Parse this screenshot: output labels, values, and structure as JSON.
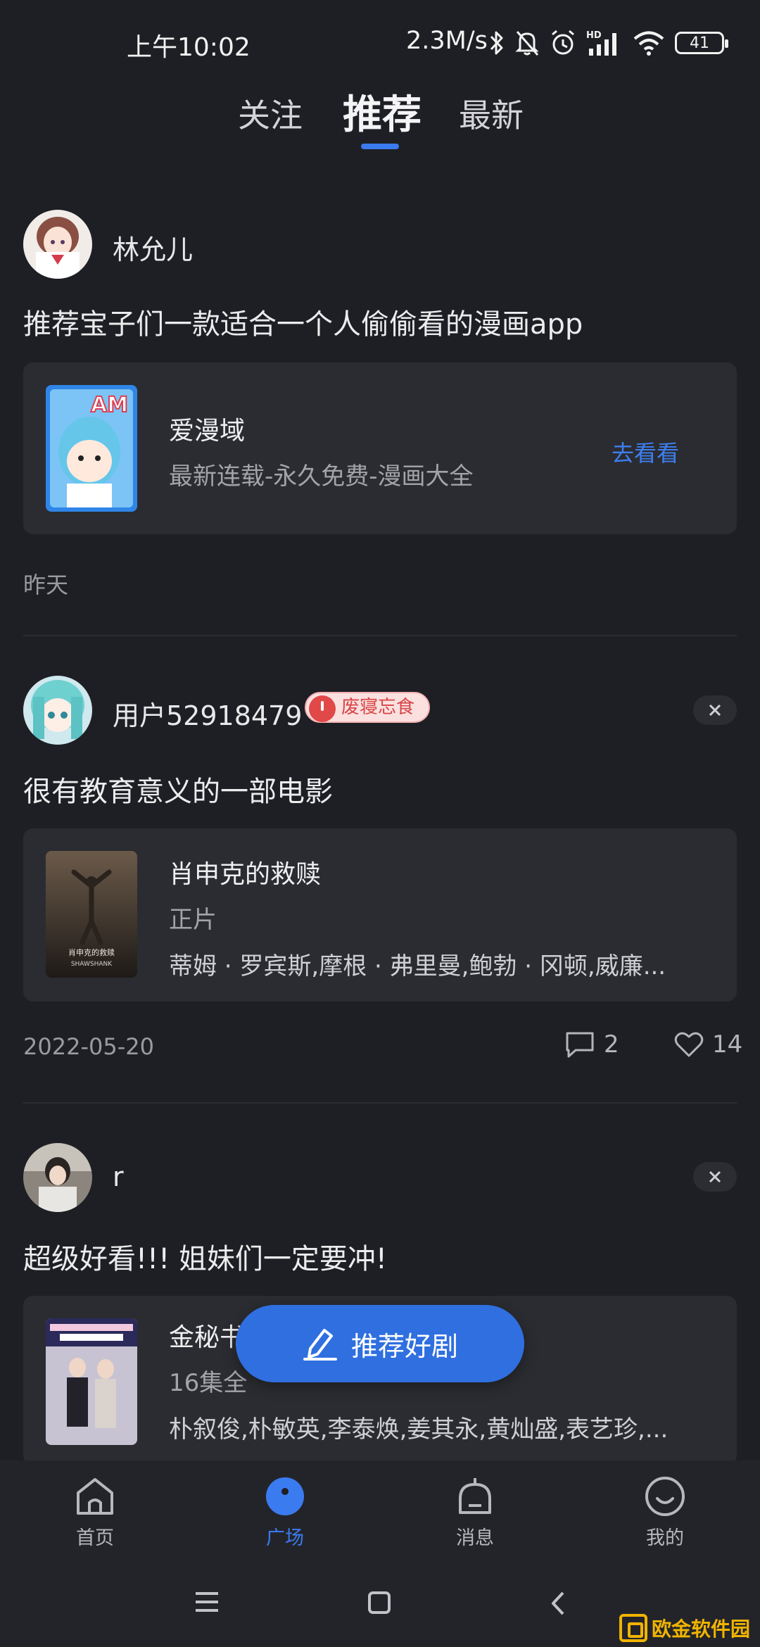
{
  "status_bar": {
    "time": "上午10:02",
    "net_speed": "2.3M/s",
    "network_label": "HD",
    "battery": "41"
  },
  "tabs": {
    "follow": "关注",
    "recommend": "推荐",
    "latest": "最新",
    "active": "推荐"
  },
  "posts": [
    {
      "username": "林允儿",
      "text": "推荐宝子们一款适合一个人偷偷看的漫画app",
      "card": {
        "title": "爱漫域",
        "subtitle": "最新连载-永久免费-漫画大全",
        "action": "去看看",
        "cover_text": "AM"
      },
      "time": "昨天"
    },
    {
      "username": "用户52918479",
      "badge": "废寝忘食",
      "text": "很有教育意义的一部电影",
      "card": {
        "title": "肖申克的救赎",
        "subtitle": "正片",
        "cast": "蒂姆 · 罗宾斯,摩根 · 弗里曼,鲍勃 · 冈顿,威廉...",
        "cover_text": "肖申克的救赎",
        "cover_subtext": "SHAWSHANK"
      },
      "time": "2022-05-20",
      "comments": "2",
      "likes": "14"
    },
    {
      "username": "r",
      "text": "超级好看!!! 姐妹们一定要冲!",
      "card": {
        "title": "金秘书",
        "subtitle": "16集全",
        "cast": "朴叙俊,朴敏英,李泰焕,姜其永,黄灿盛,表艺珍,..."
      }
    }
  ],
  "fab": {
    "label": "推荐好剧"
  },
  "bottom_nav": [
    {
      "label": "首页",
      "icon": "home-icon"
    },
    {
      "label": "广场",
      "icon": "plaza-icon",
      "active": true
    },
    {
      "label": "消息",
      "icon": "bell-icon"
    },
    {
      "label": "我的",
      "icon": "profile-icon"
    }
  ],
  "watermark": {
    "text": "欧金软件园"
  },
  "colors": {
    "accent": "#3b7bf0",
    "background": "#1e1f24",
    "card": "#2b2c31",
    "badge": "#e14848"
  }
}
